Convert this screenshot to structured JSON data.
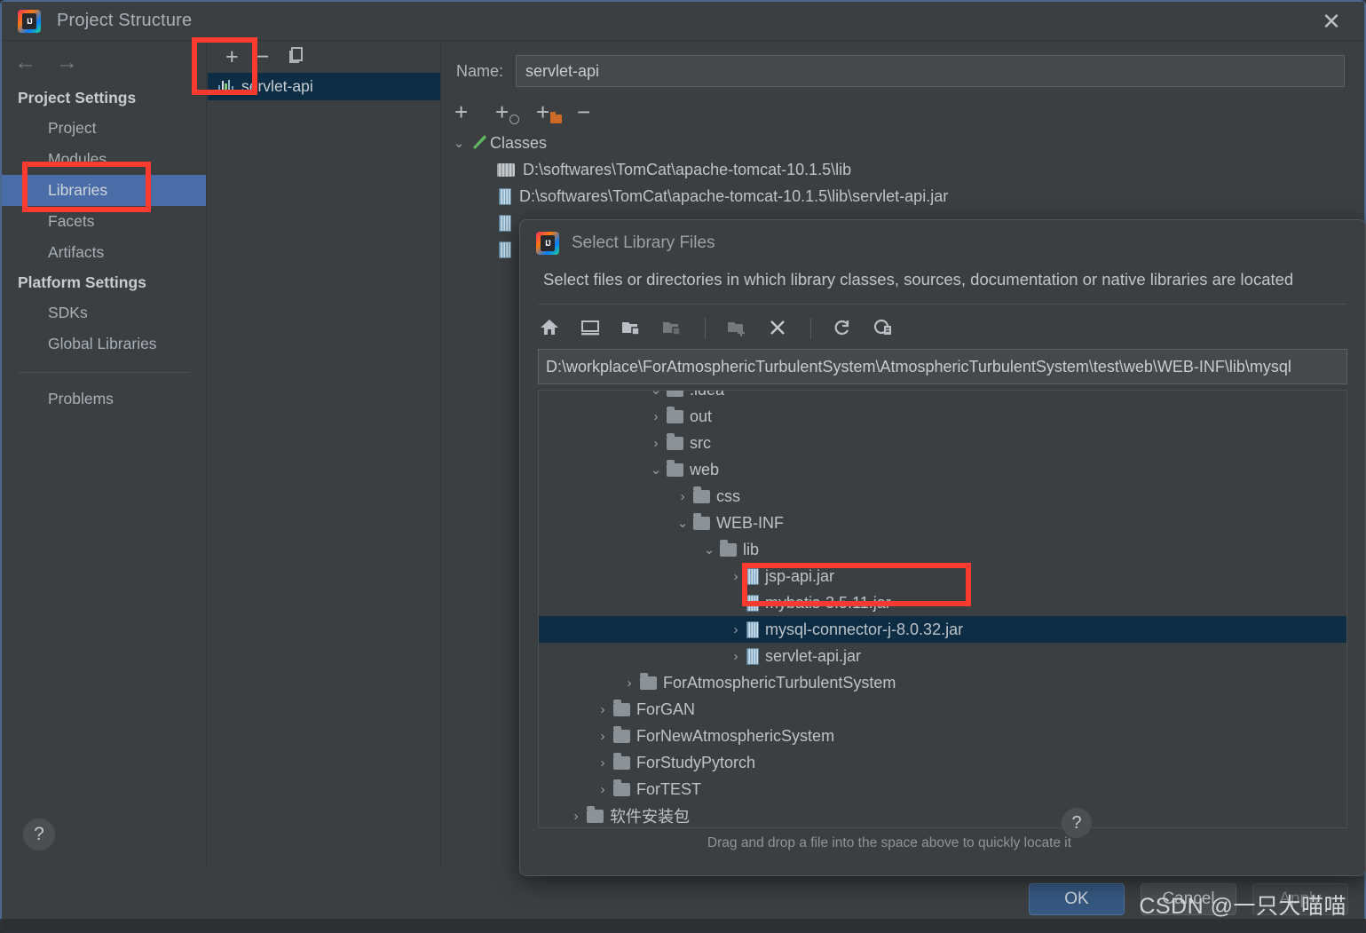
{
  "window": {
    "title": "Project Structure",
    "close_icon": "close-icon",
    "logo_text": "IJ"
  },
  "sidebar": {
    "back_icon": "arrow-left-icon",
    "forward_icon": "arrow-right-icon",
    "groups": [
      {
        "label": "Project Settings",
        "items": [
          {
            "label": "Project",
            "selected": false
          },
          {
            "label": "Modules",
            "selected": false
          },
          {
            "label": "Libraries",
            "selected": true
          },
          {
            "label": "Facets",
            "selected": false
          },
          {
            "label": "Artifacts",
            "selected": false
          }
        ]
      },
      {
        "label": "Platform Settings",
        "items": [
          {
            "label": "SDKs",
            "selected": false
          },
          {
            "label": "Global Libraries",
            "selected": false
          }
        ]
      }
    ],
    "problems_label": "Problems",
    "help_label": "?"
  },
  "library_pane": {
    "toolbar": {
      "add": "+",
      "remove": "−",
      "copy": "copy-icon"
    },
    "items": [
      {
        "label": "servlet-api",
        "selected": true
      }
    ]
  },
  "detail": {
    "name_label": "Name:",
    "name_value": "servlet-api",
    "toolbar": {
      "add": "+",
      "add_with_circle": "+",
      "add_folder": "+",
      "remove": "−"
    },
    "tree": {
      "root_label": "Classes",
      "root_icon": "hammer-icon",
      "entries": [
        {
          "label": "D:\\softwares\\TomCat\\apache-tomcat-10.1.5\\lib",
          "icon": "zip-folder-icon"
        },
        {
          "label": "D:\\softwares\\TomCat\\apache-tomcat-10.1.5\\lib\\servlet-api.jar",
          "icon": "jar-icon"
        },
        {
          "label": "",
          "icon": "jar-icon"
        },
        {
          "label": "",
          "icon": "jar-icon"
        }
      ]
    }
  },
  "dialog": {
    "title": "Select Library Files",
    "description": "Select files or directories in which library classes, sources, documentation or native libraries are located",
    "toolbar_icons": [
      "home-icon",
      "desktop-icon",
      "project-folder-icon",
      "module-folder-icon",
      "new-folder-icon",
      "delete-icon",
      "refresh-icon",
      "show-hidden-icon"
    ],
    "path_value": "D:\\workplace\\ForAtmosphericTurbulentSystem\\AtmosphericTurbulentSystem\\test\\web\\WEB-INF\\lib\\mysql",
    "tree": [
      {
        "label": ".idea",
        "icon": "folder-icon",
        "indent": 4,
        "chev": "⌄",
        "partial": true,
        "selected": false
      },
      {
        "label": "out",
        "icon": "folder-icon",
        "indent": 4,
        "chev": "›",
        "selected": false
      },
      {
        "label": "src",
        "icon": "folder-icon",
        "indent": 4,
        "chev": "›",
        "selected": false
      },
      {
        "label": "web",
        "icon": "folder-icon",
        "indent": 4,
        "chev": "⌄",
        "selected": false
      },
      {
        "label": "css",
        "icon": "folder-icon",
        "indent": 5,
        "chev": "›",
        "selected": false
      },
      {
        "label": "WEB-INF",
        "icon": "folder-icon",
        "indent": 5,
        "chev": "⌄",
        "selected": false
      },
      {
        "label": "lib",
        "icon": "folder-icon",
        "indent": 6,
        "chev": "⌄",
        "selected": false
      },
      {
        "label": "jsp-api.jar",
        "icon": "jar-icon",
        "indent": 7,
        "chev": "›",
        "selected": false
      },
      {
        "label": "mybatis-3.5.11.jar",
        "icon": "jar-icon",
        "indent": 7,
        "chev": "",
        "selected": false
      },
      {
        "label": "mysql-connector-j-8.0.32.jar",
        "icon": "jar-icon",
        "indent": 7,
        "chev": "›",
        "selected": true
      },
      {
        "label": "servlet-api.jar",
        "icon": "jar-icon",
        "indent": 7,
        "chev": "›",
        "selected": false
      },
      {
        "label": "ForAtmosphericTurbulentSystem",
        "icon": "folder-icon",
        "indent": 3,
        "chev": "›",
        "selected": false
      },
      {
        "label": "ForGAN",
        "icon": "folder-icon",
        "indent": 2,
        "chev": "›",
        "selected": false
      },
      {
        "label": "ForNewAtmosphericSystem",
        "icon": "folder-icon",
        "indent": 2,
        "chev": "›",
        "selected": false
      },
      {
        "label": "ForStudyPytorch",
        "icon": "folder-icon",
        "indent": 2,
        "chev": "›",
        "selected": false
      },
      {
        "label": "ForTEST",
        "icon": "folder-icon",
        "indent": 2,
        "chev": "›",
        "selected": false
      },
      {
        "label": "软件安装包",
        "icon": "folder-icon",
        "indent": 1,
        "chev": "›",
        "selected": false
      }
    ],
    "hint": "Drag and drop a file into the space above to quickly locate it",
    "help_label": "?"
  },
  "footer": {
    "ok": "OK",
    "cancel": "Cancel",
    "apply": "Apply"
  },
  "watermark": "CSDN @一只大喵喵",
  "colors": {
    "accent_blue": "#4a6da7",
    "selection_navy": "#0d2d44",
    "annotation_red": "#fb3b30",
    "primary_button": "#365880",
    "window_bg": "#3c3f41"
  }
}
